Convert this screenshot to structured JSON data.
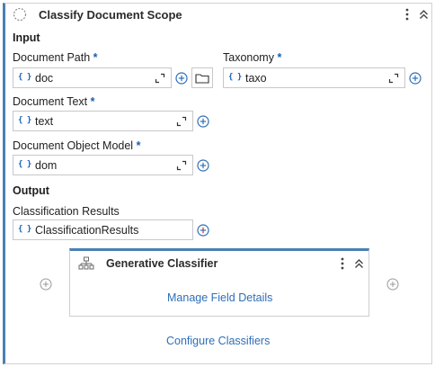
{
  "header": {
    "title": "Classify Document Scope",
    "icon": "activity-spinner-icon",
    "menu_icon": "more-vertical-icon",
    "collapse_icon": "chevrons-up-icon"
  },
  "input_section": {
    "label": "Input",
    "document_path": {
      "label": "Document Path",
      "required_mark": "*",
      "var_icon": "{ }",
      "value": "doc"
    },
    "taxonomy": {
      "label": "Taxonomy",
      "required_mark": "*",
      "var_icon": "{ }",
      "value": "taxo"
    },
    "document_text": {
      "label": "Document Text",
      "required_mark": "*",
      "var_icon": "{ }",
      "value": "text"
    },
    "document_object_model": {
      "label": "Document Object Model",
      "required_mark": "*",
      "var_icon": "{ }",
      "value": "dom"
    }
  },
  "output_section": {
    "label": "Output",
    "classification_results": {
      "label": "Classification Results",
      "var_icon": "{ }",
      "value": "ClassificationResults"
    }
  },
  "classifier": {
    "title": "Generative Classifier",
    "icon": "hierarchy-icon",
    "manage_link": "Manage Field Details"
  },
  "footer": {
    "configure_link": "Configure Classifiers"
  },
  "colors": {
    "accent": "#4a7fb5",
    "link": "#2e6fb7",
    "required": "#1a5fb4"
  }
}
